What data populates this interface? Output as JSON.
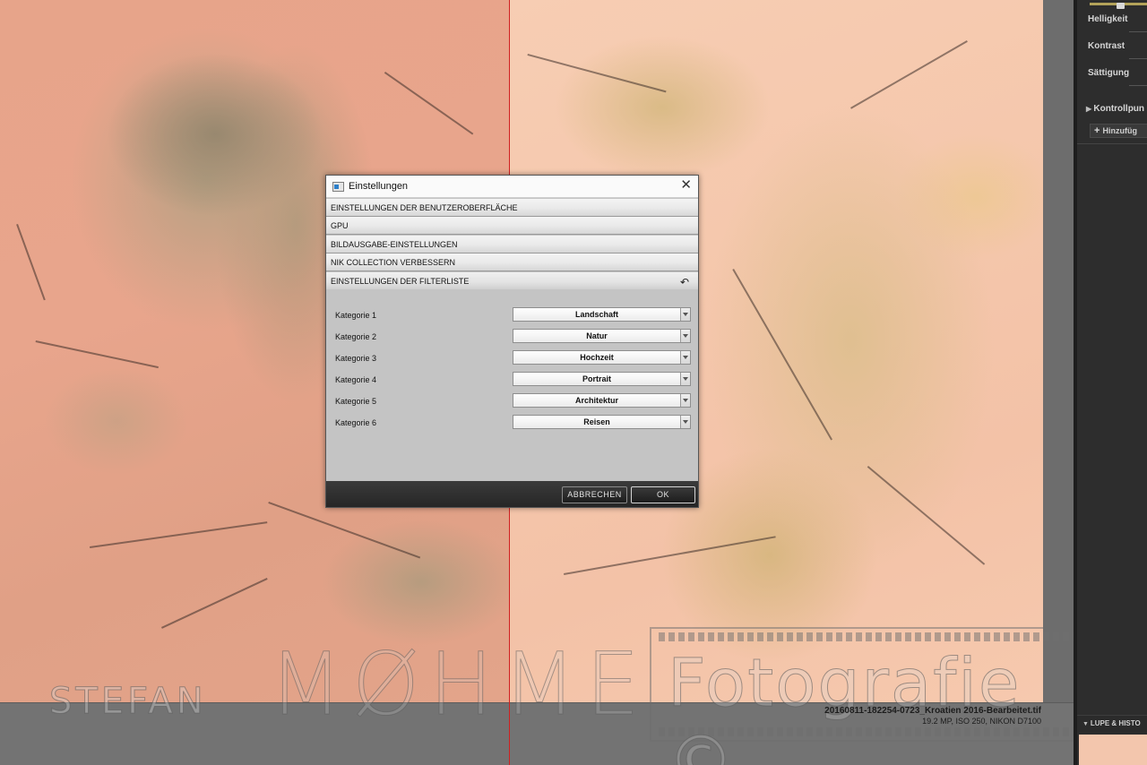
{
  "dialog": {
    "title": "Einstellungen",
    "close_glyph": "✕",
    "sections": [
      "EINSTELLUNGEN DER BENUTZEROBERFLÄCHE",
      "GPU",
      "BILDAUSGABE-EINSTELLUNGEN",
      "NIK COLLECTION VERBESSERN",
      "EINSTELLUNGEN DER FILTERLISTE"
    ],
    "reset_glyph": "↶",
    "categories": [
      {
        "label": "Kategorie 1",
        "value": "Landschaft"
      },
      {
        "label": "Kategorie 2",
        "value": "Natur"
      },
      {
        "label": "Kategorie 3",
        "value": "Hochzeit"
      },
      {
        "label": "Kategorie 4",
        "value": "Portrait"
      },
      {
        "label": "Kategorie 5",
        "value": "Architektur"
      },
      {
        "label": "Kategorie 6",
        "value": "Reisen"
      }
    ],
    "cancel_label": "ABBRECHEN",
    "ok_label": "OK"
  },
  "right_panel": {
    "adjustments": [
      "Helligkeit",
      "Kontrast",
      "Sättigung"
    ],
    "control_points": "Kontrollpun",
    "add_label": "Hinzufüg",
    "loupe_label": "LUPE & HISTO"
  },
  "status": {
    "file_name": "20160811-182254-0723_Kroatien 2016-Bearbeitet.tif",
    "file_meta": "19.2 MP, ISO 250, NIKON D7100"
  },
  "watermark": {
    "left_text": "STEFAN",
    "middle_text": "MØHME",
    "right_text": "Fotografie ©"
  },
  "colors": {
    "split_line": "#d02020",
    "dialog_bg": "#c4c4c4",
    "panel_bg": "#2d2d2d"
  }
}
